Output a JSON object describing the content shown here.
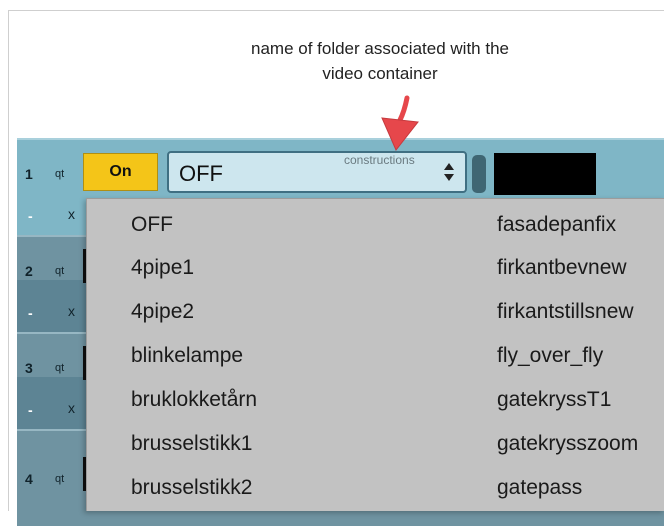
{
  "annotation": {
    "line1": "name of folder associated with the",
    "line2": "video container"
  },
  "colors": {
    "on": "#f4c518",
    "accent": "#7fb6c6",
    "arrow": "#e6474b"
  },
  "rows": [
    {
      "number": "1",
      "qt": "qt",
      "minus": "-",
      "x": "x"
    },
    {
      "number": "2",
      "qt": "qt",
      "minus": "-",
      "x": "x"
    },
    {
      "number": "3",
      "qt": "qt",
      "minus": "-",
      "x": "x"
    },
    {
      "number": "4",
      "qt": "qt"
    }
  ],
  "on_button": {
    "label": "On"
  },
  "select": {
    "value": "OFF",
    "hint": "constructions",
    "icon": "updown-arrows-icon"
  },
  "dropdown": {
    "left": [
      "OFF",
      "4pipe1",
      "4pipe2",
      "blinkelampe",
      "bruklokketårn",
      "brusselstikk1",
      "brusselstikk2"
    ],
    "right": [
      "fasadepanfix",
      "firkantbevnew",
      "firkantstillsnew",
      "fly_over_fly",
      "gatekryssT1",
      "gatekrysszoom",
      "gatepass"
    ]
  }
}
